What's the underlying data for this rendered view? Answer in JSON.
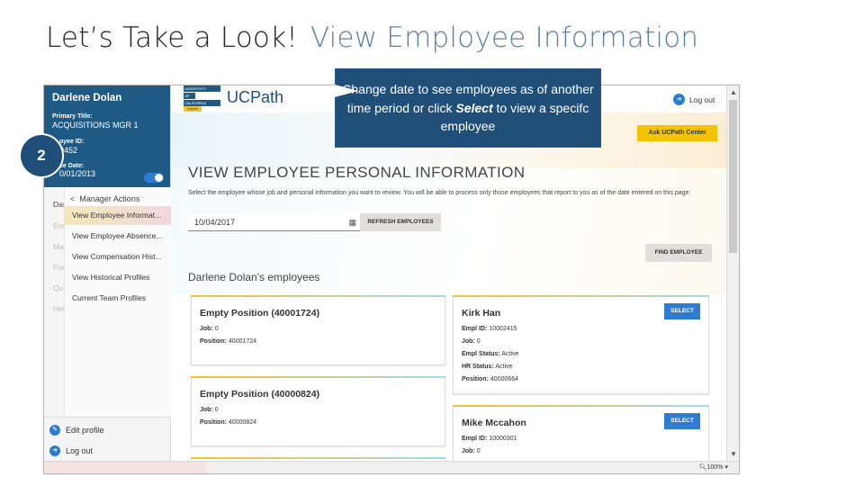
{
  "slide": {
    "title": "Let’s Take a Look!",
    "subtitle": "View Employee Information",
    "step_number": "2",
    "callout_part1": "Change date to see employees as of another time period or click ",
    "callout_bold": "Select",
    "callout_part2": " to view a specifc employee"
  },
  "sidebar": {
    "name": "Darlene Dolan",
    "primary_title_label": "Primary Title:",
    "primary_title_value": "ACQUISITIONS MGR 1",
    "employee_id_label": "oyee ID:",
    "employee_id_value": "0452",
    "service_date_label": "ce Date:",
    "service_date_value": "0/01/2013",
    "left_stub": [
      "Das",
      "Emp",
      "Mai",
      "For",
      "Qui",
      "Hel"
    ],
    "menu_back": "<",
    "menu_head": "Manager Actions",
    "menu_items": [
      "View Employee Informat...",
      "View Employee Absence...",
      "View Compensation Hist...",
      "View Historical Profiles",
      "Current Team Profiles"
    ],
    "edit_profile": "Edit profile",
    "log_out": "Log out"
  },
  "header": {
    "logo_text": "UCPath",
    "logo_line1": "UNIVERSITY",
    "logo_line2": "OF",
    "logo_line3": "CALIFORNIA",
    "logo_tag": "dripws",
    "log_out": "Log out",
    "ask_button": "Ask UCPath Center"
  },
  "main": {
    "title": "VIEW EMPLOYEE PERSONAL INFORMATION",
    "description": "Select the employee whose job and personal information you want to review. You will be able to process only those employees that report to you as of the date entered on this page.",
    "date_value": "10/04/2017",
    "refresh_button": "REFRESH EMPLOYEES",
    "find_button": "FIND EMPLOYEE",
    "section_heading": "Darlene Dolan's employees",
    "select_label": "SELECT",
    "cards": [
      {
        "title": "Empty Position (40001724)",
        "job_label": "Job:",
        "job": "0",
        "position_label": "Position:",
        "position": "40001724"
      },
      {
        "title": "Empty Position (40000824)",
        "job_label": "Job:",
        "job": "0",
        "position_label": "Position:",
        "position": "40000824"
      },
      {
        "title": "Kirk Han",
        "empl_id_label": "Empl ID:",
        "empl_id": "10002415",
        "job_label": "Job:",
        "job": "0",
        "empl_status_label": "Empl Status:",
        "empl_status": "Active",
        "hr_status_label": "HR Status:",
        "hr_status": "Active",
        "position_label": "Position:",
        "position": "40000664"
      },
      {
        "title": "Mike Mccahon",
        "empl_id_label": "Empl ID:",
        "empl_id": "10000301",
        "job_label": "Job:",
        "job": "0"
      }
    ]
  },
  "statusbar": {
    "zoom": "100%",
    "zoom_icon": "magnifier-icon"
  },
  "colors": {
    "brand_blue": "#1f4e79",
    "accent_blue": "#2d7ccf",
    "accent_yellow": "#f5c400"
  }
}
